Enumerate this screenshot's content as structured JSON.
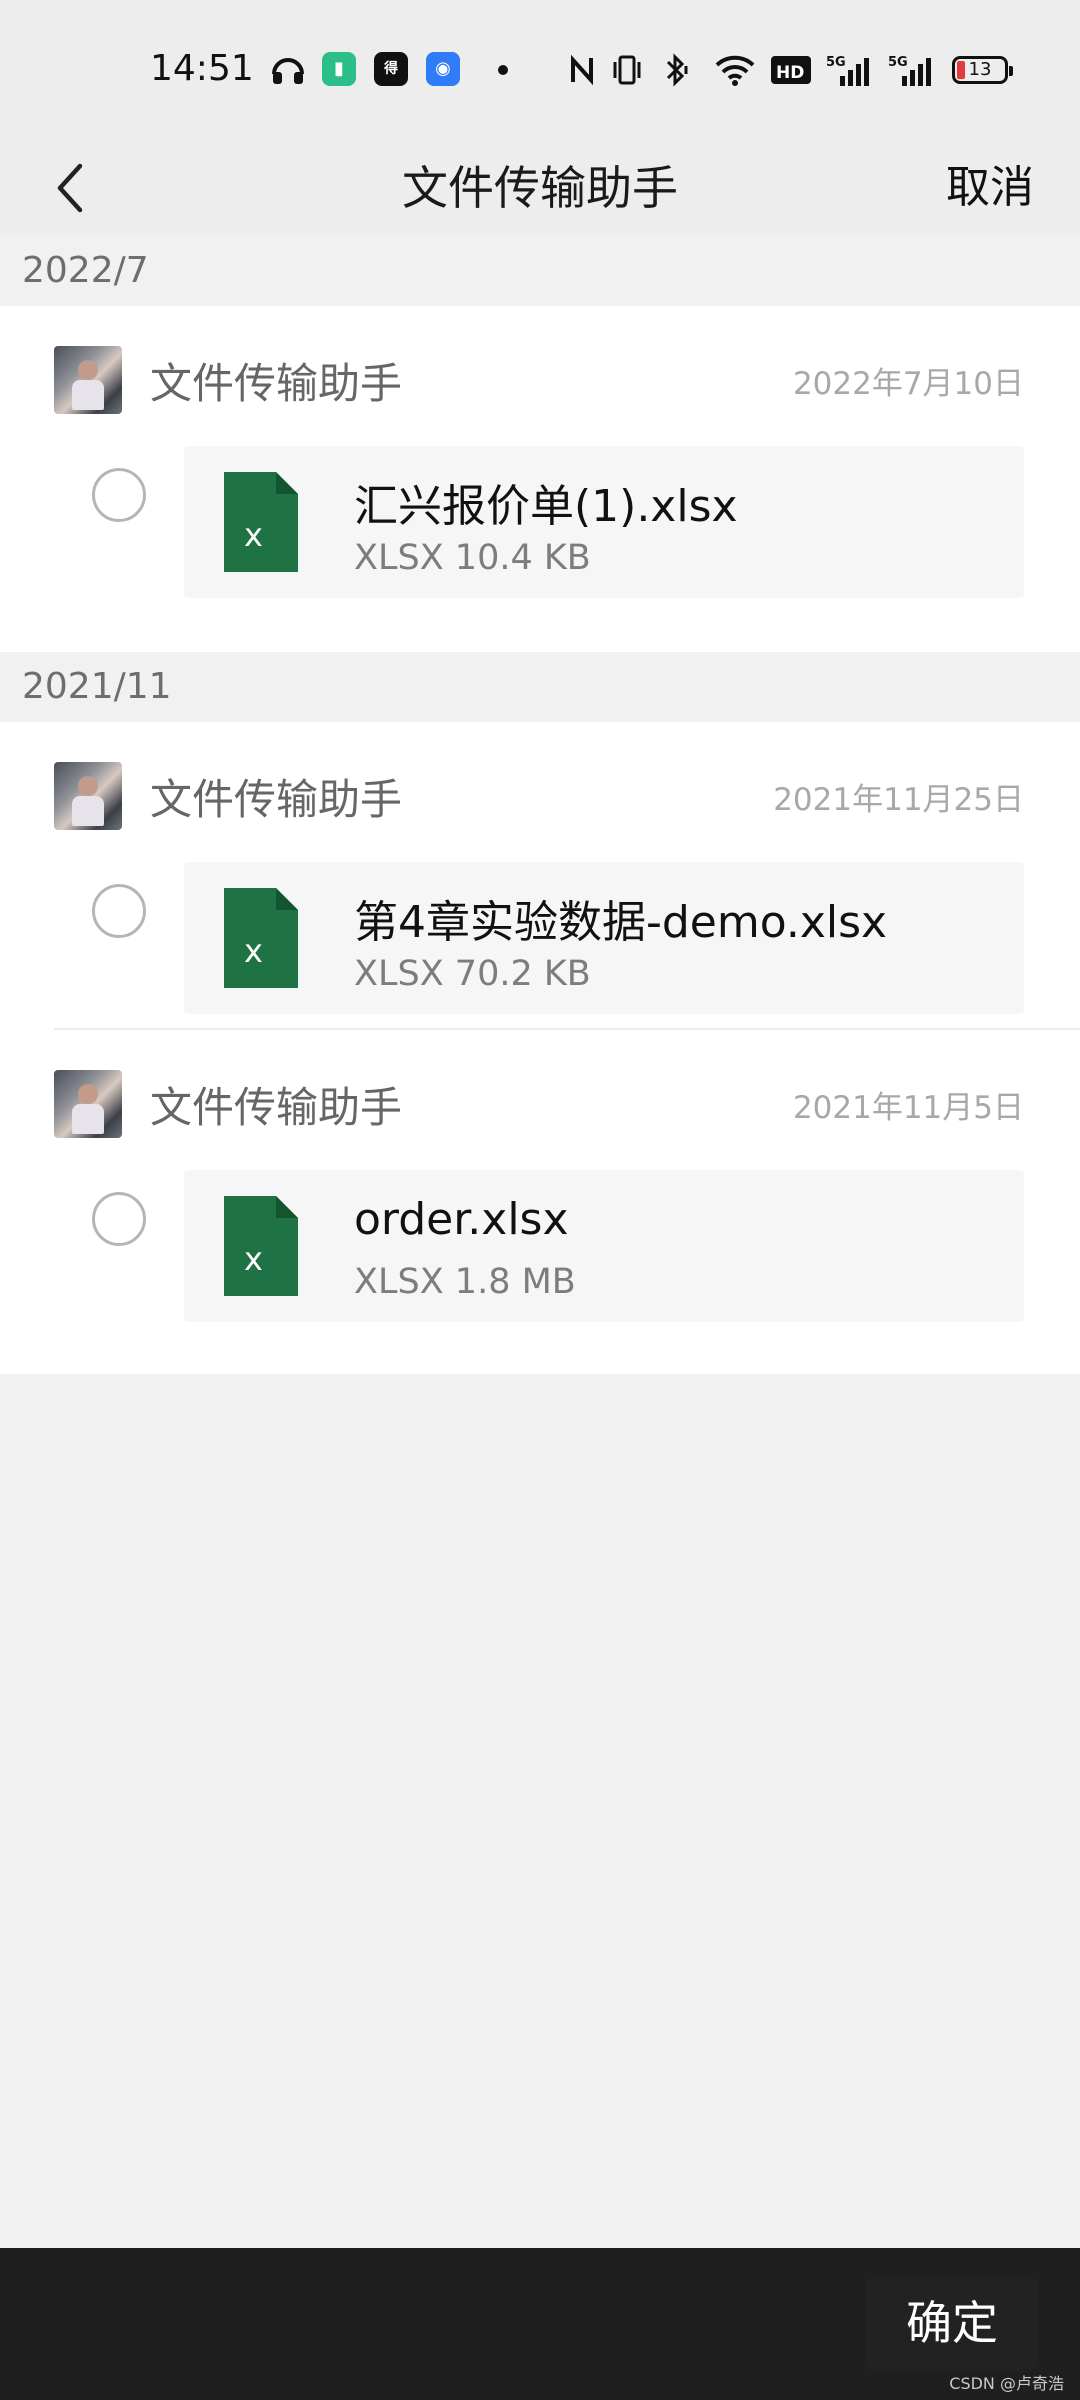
{
  "status_bar": {
    "time": "14:51",
    "battery_level": "13",
    "icons": [
      "headphones-icon",
      "battery-app-icon",
      "app-icon",
      "shield-app-icon",
      "dot-icon",
      "nfc-icon",
      "vibrate-icon",
      "bluetooth-icon",
      "wifi-icon",
      "hd-icon",
      "signal-5g-icon",
      "signal-5g-icon",
      "battery-icon"
    ]
  },
  "header": {
    "title": "文件传输助手",
    "cancel_label": "取消",
    "back_icon": "chevron-left-icon"
  },
  "groups": [
    {
      "label": "2022/7",
      "entries": [
        {
          "sender": "文件传输助手",
          "date": "2022年7月10日",
          "file_name": "汇兴报价单(1).xlsx",
          "file_meta": "XLSX 10.4 KB",
          "selected": false
        }
      ]
    },
    {
      "label": "2021/11",
      "entries": [
        {
          "sender": "文件传输助手",
          "date": "2021年11月25日",
          "file_name": "第4章实验数据-demo.xlsx",
          "file_meta": "XLSX 70.2 KB",
          "selected": false
        },
        {
          "sender": "文件传输助手",
          "date": "2021年11月5日",
          "file_name": "order.xlsx",
          "file_meta": "XLSX 1.8 MB",
          "selected": false
        }
      ]
    }
  ],
  "footer": {
    "confirm_label": "确定",
    "watermark": "CSDN @卢奇浩"
  },
  "colors": {
    "excel_green": "#1f7244",
    "page_bg": "#f1f1f1",
    "bottom_bar": "#1f1f1f"
  }
}
